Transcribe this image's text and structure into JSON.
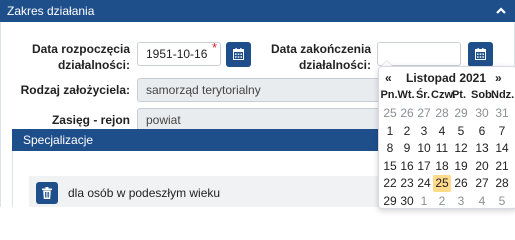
{
  "panel": {
    "title": "Zakres działania",
    "toggle_icon": "chevron-up-icon"
  },
  "form": {
    "start_date": {
      "label_line1": "Data rozpoczęcia",
      "label_line2": "działalności:",
      "value": "1951-10-16",
      "required_mark": "*"
    },
    "end_date": {
      "label_line1": "Data zakończenia",
      "label_line2": "działalności:",
      "value": ""
    },
    "founder_type": {
      "label": "Rodzaj założyciela:",
      "value": "samorząd terytorialny"
    },
    "scope": {
      "label": "Zasięg - rejon działania:",
      "value": "powiat"
    }
  },
  "specializations": {
    "title": "Specjalizacje",
    "items": [
      {
        "label": "dla osób w podeszłym wieku"
      }
    ]
  },
  "datepicker": {
    "prev": "«",
    "next": "»",
    "month_title": "Listopad 2021",
    "weekdays": [
      "Pn.",
      "Wt.",
      "Śr.",
      "Czw.",
      "Pt.",
      "Sob.",
      "Ndz."
    ],
    "weeks": [
      [
        "25",
        "26",
        "27",
        "28",
        "29",
        "30",
        "31"
      ],
      [
        "1",
        "2",
        "3",
        "4",
        "5",
        "6",
        "7"
      ],
      [
        "8",
        "9",
        "10",
        "11",
        "12",
        "13",
        "14"
      ],
      [
        "15",
        "16",
        "17",
        "18",
        "19",
        "20",
        "21"
      ],
      [
        "22",
        "23",
        "24",
        "25",
        "26",
        "27",
        "28"
      ],
      [
        "29",
        "30",
        "1",
        "2",
        "3",
        "4",
        "5"
      ]
    ],
    "muted_first_row": true,
    "muted_last_row_from": 2,
    "today": "25",
    "today_color": "#ffdb8a"
  },
  "colors": {
    "primary": "#1f4f8b",
    "required": "#d9232e"
  }
}
